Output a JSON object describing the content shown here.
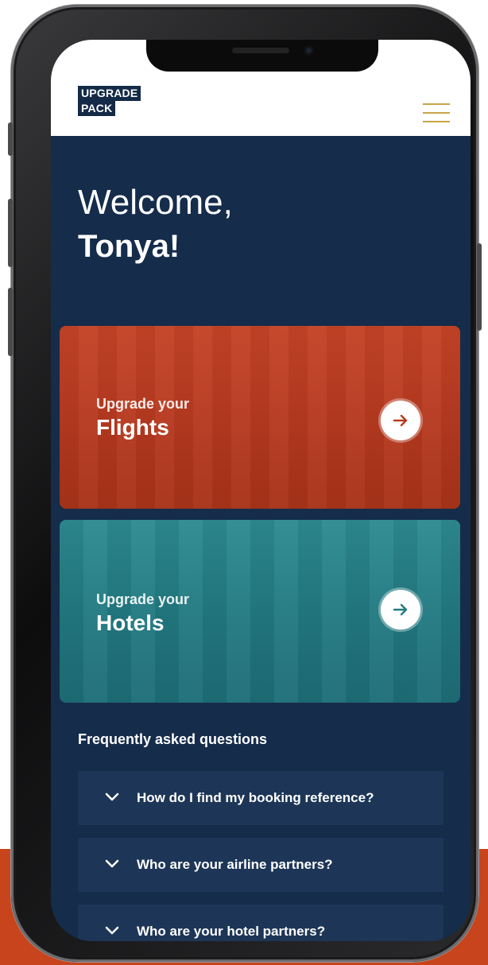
{
  "colors": {
    "background_accent": "#c8441c",
    "screen_background": "#152c4b",
    "logo_background": "#142a47",
    "menu_accent": "#c9a349",
    "flights_card": "#b73a20",
    "hotels_card": "#237a82",
    "faq_item": "#1d3657"
  },
  "header": {
    "logo_line1": "UPGRADE",
    "logo_line2": "PACK",
    "menu_icon": "hamburger-menu-icon"
  },
  "welcome": {
    "greeting": "Welcome,",
    "name": "Tonya!"
  },
  "cards": [
    {
      "subtitle": "Upgrade your",
      "title": "Flights",
      "icon": "arrow-right-icon"
    },
    {
      "subtitle": "Upgrade your",
      "title": "Hotels",
      "icon": "arrow-right-icon"
    }
  ],
  "faq": {
    "heading": "Frequently asked questions",
    "items": [
      {
        "question": "How do I find my booking reference?",
        "icon": "chevron-down-icon"
      },
      {
        "question": "Who are your airline partners?",
        "icon": "chevron-down-icon"
      },
      {
        "question": "Who are your hotel partners?",
        "icon": "chevron-down-icon"
      }
    ]
  }
}
